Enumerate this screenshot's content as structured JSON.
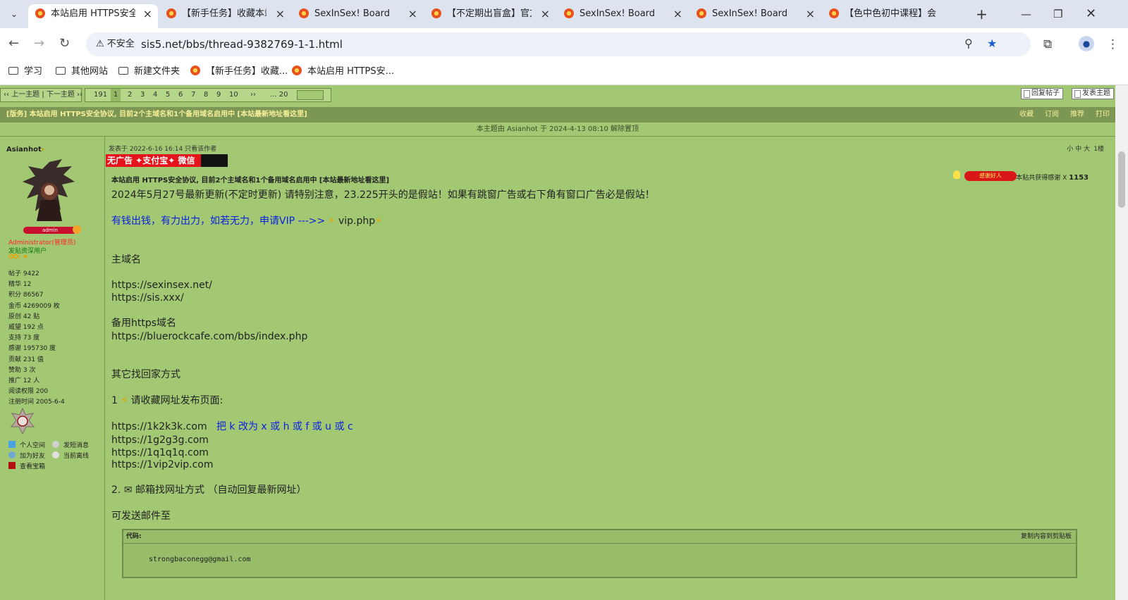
{
  "browser": {
    "tabs": [
      {
        "label": "本站启用 HTTPS安全协",
        "active": true
      },
      {
        "label": "【新手任务】收藏本站",
        "active": false
      },
      {
        "label": "SexInSex! Board",
        "active": false
      },
      {
        "label": "【不定期出盲盒】官方",
        "active": false
      },
      {
        "label": "SexInSex! Board",
        "active": false
      },
      {
        "label": "SexInSex! Board",
        "active": false
      },
      {
        "label": "【色中色初中课程】会",
        "active": false
      }
    ],
    "insecure_label": "不安全",
    "url": "sis5.net/bbs/thread-9382769-1-1.html",
    "bookmarks": [
      {
        "label": "学习",
        "icon": "folder-icon"
      },
      {
        "label": "其他网站",
        "icon": "folder-icon"
      },
      {
        "label": "新建文件夹",
        "icon": "folder-icon"
      },
      {
        "label": "【新手任务】收藏...",
        "icon": "site-favicon"
      },
      {
        "label": "本站启用 HTTPS安...",
        "icon": "site-favicon"
      }
    ]
  },
  "pager": {
    "prev_next": "‹‹ 上一主题 | 下一主题 ››",
    "total": "191",
    "pages": [
      "1",
      "2",
      "3",
      "4",
      "5",
      "6",
      "7",
      "8",
      "9",
      "10"
    ],
    "next": "››",
    "last": "... 20",
    "reply_label": "回复帖子",
    "new_label": "发表主题"
  },
  "thread": {
    "title": "[版务] 本站启用 HTTPS安全协议, 目前2个主域名和1个备用域名启用中 [本站最新地址看这里]",
    "links": [
      "收藏",
      "订阅",
      "推荐",
      "打印"
    ],
    "pin_notice": "本主题由 Asianhot 于 2024-4-13 08:10 解除置顶"
  },
  "author": {
    "name": "Asianhot",
    "badge": "admin",
    "group": "Administrator(管理员)",
    "title": "发贴资深用户",
    "stars": "✪✪☾★",
    "stats": [
      "帖子 9422",
      "精华 12",
      "积分 86567",
      "金币 4269009 枚",
      "原创 42 贴",
      "威望 192 点",
      "支持 73 度",
      "感谢 195730 度",
      "贡献 231 值",
      "赞助 3 次",
      "推广 12 人",
      "阅读权限 200",
      "注册时间 2005-6-4"
    ],
    "links": [
      "个人空间",
      "发短消息",
      "加为好友",
      "当前离线",
      "查看宝箱"
    ]
  },
  "post": {
    "meta": "发表于 2022-6-16 16:14  只看该作者",
    "font_sizes": "小 中 大",
    "floor": "1楼",
    "ad": "无广告 ✦支付宝✦ 微信",
    "subject": "本站启用 HTTPS安全协议, 目前2个主域名和1个备用域名启用中 [本站最新地址看这里]",
    "thanks_label": "本贴共获得感谢 X",
    "thanks_count": "1153",
    "thanks_badge": "感谢好人",
    "lines": [
      "2024年5月27号最新更新(不定时更新) 请特别注意，23.225开头的是假站！如果有跳窗广告或右下角有窗口广告必是假站！",
      "有钱出钱，有力出力，如若无力，申请VIP --->>",
      "vip.php",
      "主域名",
      "https://sexinsex.net/",
      "https://sis.xxx/",
      "备用https域名",
      "https://bluerockcafe.com/bbs/index.php",
      "其它找回家方式",
      "1",
      "请收藏网址发布页面:",
      "https://1k2k3k.com",
      "把 k 改为 x 或 h 或 f 或 u 或 c",
      "https://1g2g3g.com",
      "https://1q1q1q.com",
      "https://1vip2vip.com",
      "2.",
      "邮箱找网址方式 （自动回复最新网址）",
      "可发送邮件至"
    ],
    "code_label": "代码:",
    "code_copy": "复制内容到剪贴板",
    "code": "strongbaconegg@gmail.com"
  }
}
